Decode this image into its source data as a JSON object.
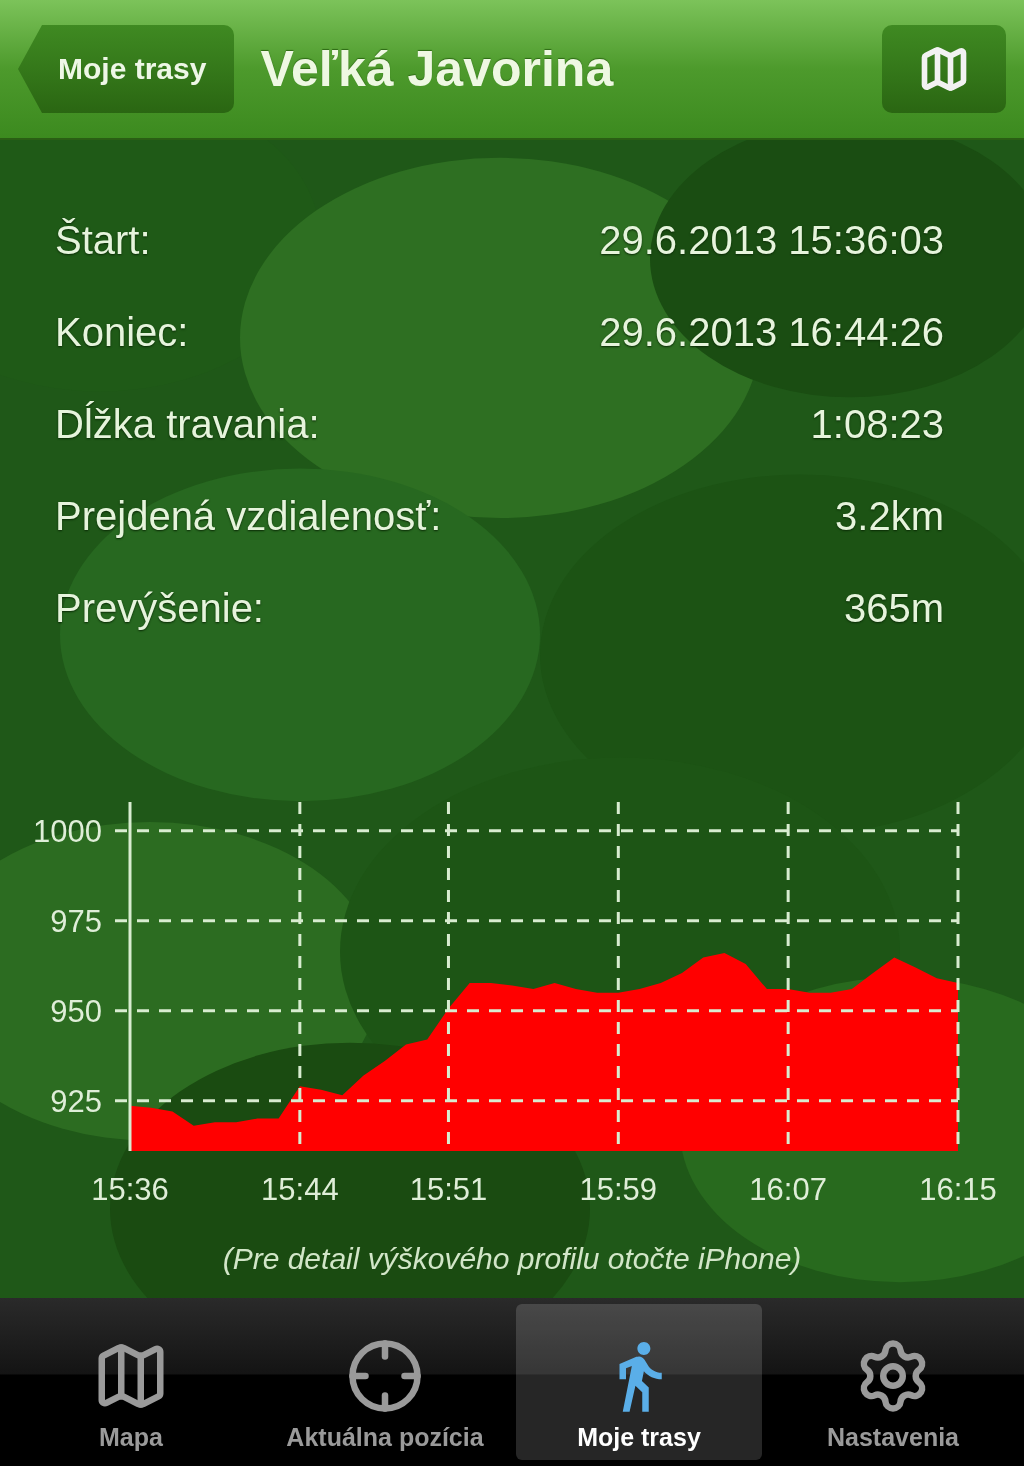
{
  "nav_bar": {
    "back_button": "Moje trasy",
    "title": "Veľká Javorina"
  },
  "stats": [
    {
      "label": "Štart:",
      "value": "29.6.2013 15:36:03"
    },
    {
      "label": "Koniec:",
      "value": "29.6.2013 16:44:26"
    },
    {
      "label": "Dĺžka travania:",
      "value": "1:08:23"
    },
    {
      "label": "Prejdená vzdialenosť:",
      "value": "3.2km"
    },
    {
      "label": "Prevýšenie:",
      "value": "365m"
    }
  ],
  "elevation_profile": {
    "chart_data": {
      "type": "area",
      "ylim": [
        911,
        1008
      ],
      "categories": [
        "15:36",
        null,
        null,
        null,
        null,
        null,
        null,
        null,
        "15:44",
        null,
        null,
        null,
        null,
        null,
        null,
        "15:51",
        null,
        null,
        null,
        null,
        null,
        null,
        null,
        "15:59",
        null,
        null,
        null,
        null,
        null,
        null,
        null,
        "16:07",
        null,
        null,
        null,
        null,
        null,
        null,
        null,
        "16:15"
      ],
      "series": [
        {
          "color": "#ff0000",
          "values": [
            923.6,
            923,
            922,
            918,
            919,
            919,
            920,
            920,
            929,
            928,
            926.5,
            932,
            936,
            940.6,
            942,
            950.6,
            957.7,
            957.7,
            957,
            956,
            957.7,
            956,
            955,
            955,
            956,
            957.7,
            960.5,
            964.8,
            966,
            963,
            956,
            956,
            955,
            955,
            956,
            960.5,
            964.8,
            962,
            959,
            957.7
          ]
        }
      ],
      "yticks": [
        925,
        950,
        975,
        1000
      ],
      "grid": true
    },
    "caption": "(Pre detail výškového profilu otočte iPhone)"
  },
  "tab_bar": [
    {
      "kind": "map",
      "label": "Mapa",
      "selected": false
    },
    {
      "kind": "position",
      "label": "Aktuálna pozícia",
      "selected": false
    },
    {
      "kind": "walk",
      "label": "Moje trasy",
      "selected": true
    },
    {
      "kind": "settings",
      "label": "Nastavenia",
      "selected": false
    }
  ]
}
